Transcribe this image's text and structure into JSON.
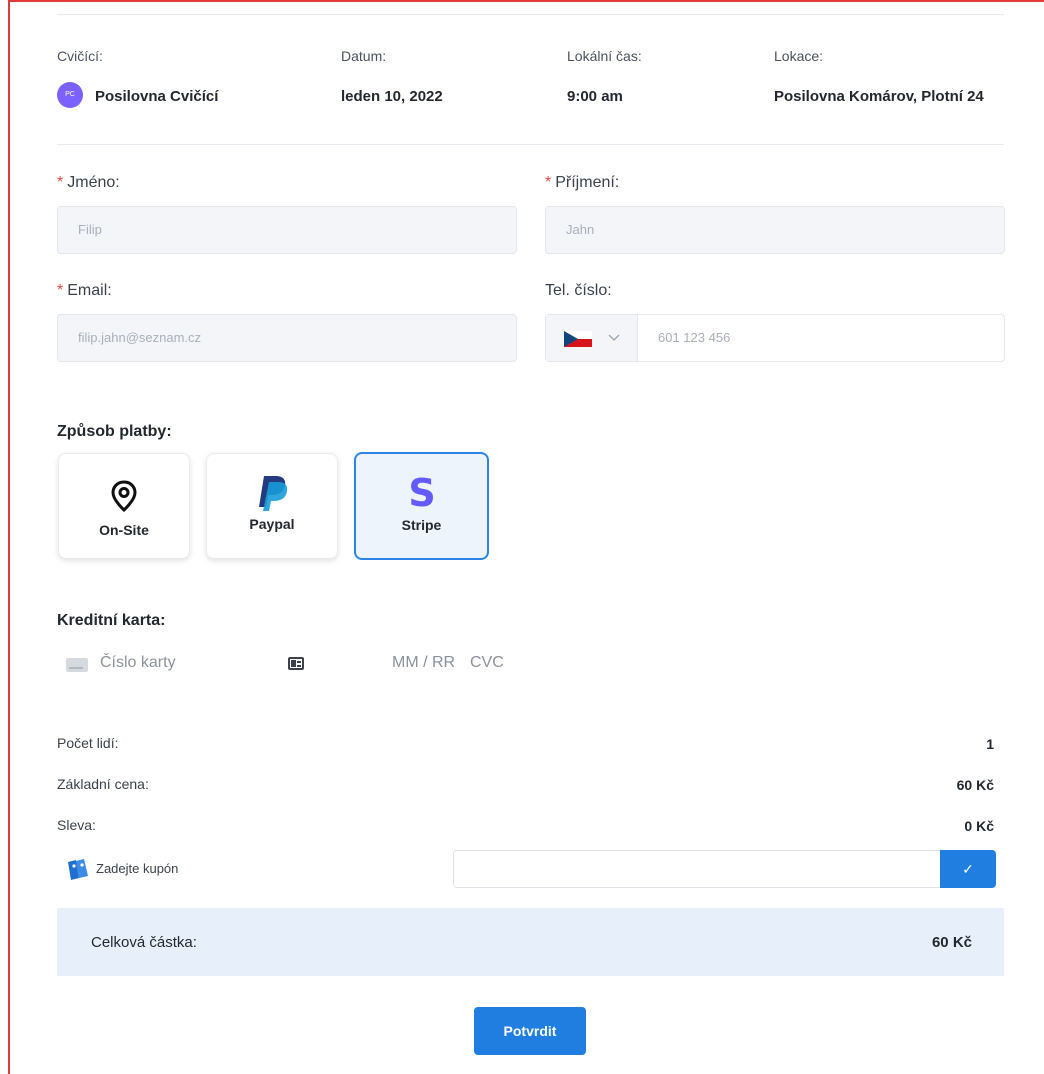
{
  "booking": {
    "trainer_label": "Cvičící:",
    "trainer_initials": "PC",
    "trainer_name": "Posilovna Cvičící",
    "date_label": "Datum:",
    "date_value": "leden 10, 2022",
    "time_label": "Lokální čas:",
    "time_value": "9:00 am",
    "location_label": "Lokace:",
    "location_value": "Posilovna Komárov, Plotní 24"
  },
  "form": {
    "first_name_label": "Jméno:",
    "first_name_value": "Filip",
    "last_name_label": "Příjmení:",
    "last_name_value": "Jahn",
    "email_label": "Email:",
    "email_value": "filip.jahn@seznam.cz",
    "phone_label": "Tel. číslo:",
    "phone_value": "601 123 456",
    "required_mark": "*"
  },
  "payment": {
    "title": "Způsob platby:",
    "methods": [
      {
        "label": "On-Site",
        "icon": "location-pin-icon"
      },
      {
        "label": "Paypal",
        "icon": "paypal-logo-icon"
      },
      {
        "label": "Stripe",
        "icon": "stripe-logo-icon",
        "selected": true
      }
    ]
  },
  "card": {
    "title": "Kreditní karta:",
    "number_placeholder": "Číslo karty",
    "expiry_placeholder": "MM / RR",
    "cvc_placeholder": "CVC"
  },
  "summary": {
    "people_label": "Počet lidí:",
    "people_value": "1",
    "base_price_label": "Základní cena:",
    "base_price_value": "60 Kč",
    "discount_label": "Sleva:",
    "discount_value": "0 Kč",
    "coupon_label": "Zadejte kupón",
    "coupon_button": "✓",
    "total_label": "Celková částka:",
    "total_value": "60 Kč"
  },
  "actions": {
    "confirm_label": "Potvrdit"
  },
  "colors": {
    "accent": "#1f7ee0",
    "avatar": "#7b61ff",
    "required": "#e24b3b",
    "total_bg": "#e7f0fa"
  }
}
